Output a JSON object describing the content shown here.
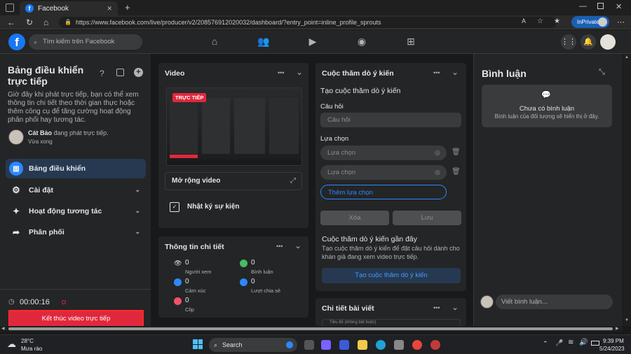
{
  "browser": {
    "tab_title": "Facebook",
    "tab_close": "✕",
    "new_tab": "+",
    "url": "https://www.facebook.com/live/producer/v2/208576912020032/dashboard/?entry_point=inline_profile_sprouts",
    "inprivate": "InPrivate"
  },
  "fbnav": {
    "search_placeholder": "Tìm kiếm trên Facebook"
  },
  "sidebar": {
    "title": "Bảng điều khiển trực tiếp",
    "description": "Giờ đây khi phát trực tiếp, bạn có thể xem thông tin chi tiết theo thời gian thực hoặc thêm công cụ để tăng cường hoạt động phân phối hay tương tác.",
    "user_name": "Cát Bảo",
    "user_status": "đang phát trực tiếp.",
    "user_time": "Vừa xong",
    "items": [
      {
        "label": "Bảng điều khiển"
      },
      {
        "label": "Cài đặt"
      },
      {
        "label": "Hoạt động tương tác"
      },
      {
        "label": "Phân phối"
      }
    ],
    "timer": "00:00:16",
    "end_button": "Kết thúc video trực tiếp"
  },
  "video_card": {
    "title": "Video",
    "live_badge": "TRỰC TIẾP",
    "expand_label": "Mở rộng video",
    "log_label": "Nhật ký sự kiện"
  },
  "insights_card": {
    "title": "Thông tin chi tiết",
    "stats": [
      {
        "value": "0",
        "label": "Người xem"
      },
      {
        "value": "0",
        "label": "Bình luận"
      },
      {
        "value": "0",
        "label": "Cảm xúc"
      },
      {
        "value": "0",
        "label": "Lượt chia sẻ"
      },
      {
        "value": "0",
        "label": "Clip"
      }
    ]
  },
  "poll_card": {
    "title": "Cuộc thăm dò ý kiến",
    "create_title": "Tạo cuộc thăm dò ý kiến",
    "question_label": "Câu hỏi",
    "question_placeholder": "Câu hỏi",
    "options_label": "Lựa chọn",
    "option1_placeholder": "Lựa chọn",
    "option2_placeholder": "Lựa chọn",
    "add_option": "Thêm lựa chọn",
    "delete_btn": "Xóa",
    "save_btn": "Lưu",
    "recent_title": "Cuộc thăm dò ý kiến gần đây",
    "recent_desc": "Tạo cuộc thăm dò ý kiến để đặt câu hỏi dành cho khán giả đang xem video trực tiếp.",
    "create_btn": "Tạo cuộc thăm dò ý kiến"
  },
  "post_card": {
    "title": "Chi tiết bài viết",
    "placeholder": "Tiêu đề (không bắt buộc)"
  },
  "comments": {
    "title": "Bình luận",
    "empty_title": "Chưa có bình luận",
    "empty_desc": "Bình luận của đối tượng sẽ hiển thị ở đây.",
    "write_placeholder": "Viết bình luận..."
  },
  "taskbar": {
    "weather_temp": "28°C",
    "weather_desc": "Mưa rào",
    "search": "Search",
    "time": "9:39 PM",
    "date": "5/24/2023"
  },
  "icons": {
    "more": "•••",
    "chevron": "⌄"
  }
}
